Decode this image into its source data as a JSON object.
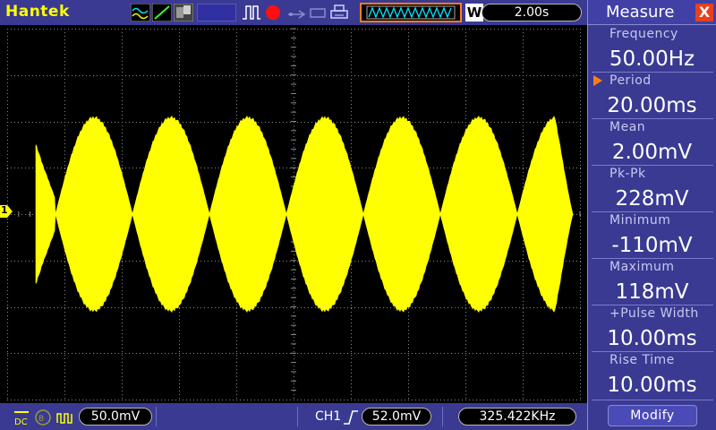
{
  "brand": "Hantek",
  "topbar": {
    "timebase": "2.00s",
    "icons": [
      "wave-cursor-icon",
      "ramp-icon",
      "display-icon",
      "pulse-icon",
      "record-icon",
      "usb-icon",
      "printer-icon",
      "trigger-position-icon",
      "trigger-mode-icon"
    ],
    "trigger_mode": "W"
  },
  "channel": {
    "marker": "1",
    "scale": "50.0mV",
    "name": "CH1",
    "trigger_level": "52.0mV",
    "frequency": "325.422KHz",
    "color": "#ffff00"
  },
  "measure": {
    "title": "Measure",
    "close": "X",
    "items": [
      {
        "label": "Frequency",
        "value": "50.00Hz"
      },
      {
        "label": "Period",
        "value": "20.00ms"
      },
      {
        "label": "Mean",
        "value": "2.00mV"
      },
      {
        "label": "Pk-Pk",
        "value": "228mV"
      },
      {
        "label": "Minimum",
        "value": "-110mV"
      },
      {
        "label": "Maximum",
        "value": "118mV"
      },
      {
        "label": "+Pulse Width",
        "value": "10.00ms"
      },
      {
        "label": "Rise Time",
        "value": "10.00ms"
      }
    ],
    "selected_index": 1,
    "modify_label": "Modify"
  },
  "colors": {
    "bar": "#3a3a92",
    "trace": "#ffff00",
    "grid": "#8a8a8a",
    "accent": "#ff7f1a"
  }
}
